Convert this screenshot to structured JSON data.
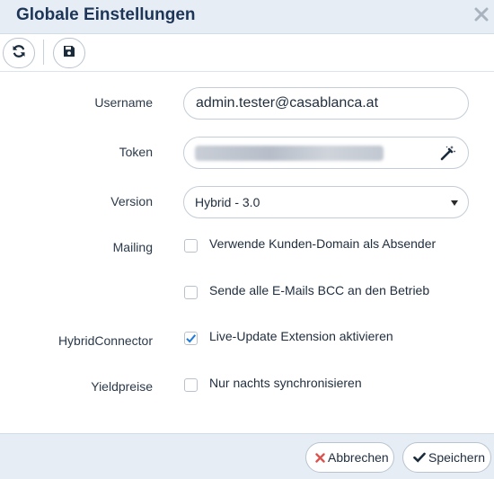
{
  "dialog": {
    "title": "Globale Einstellungen",
    "close_glyph": "✕"
  },
  "toolbar": {
    "refresh_icon": "refresh-icon",
    "save_icon": "floppy-disk-icon"
  },
  "form": {
    "username": {
      "label": "Username",
      "value": "admin.tester@casablanca.at"
    },
    "token": {
      "label": "Token",
      "value_visible": false,
      "action_icon": "magic-wand-icon"
    },
    "version": {
      "label": "Version",
      "selected": "Hybrid - 3.0"
    },
    "mailing": {
      "label": "Mailing",
      "options": [
        {
          "label": "Verwende Kunden-Domain als Absender",
          "checked": false
        },
        {
          "label": "Sende alle E-Mails BCC an den Betrieb",
          "checked": false
        }
      ]
    },
    "hybrid_connector": {
      "label": "HybridConnector",
      "option": {
        "label": "Live-Update Extension aktivieren",
        "checked": true
      }
    },
    "yieldpreise": {
      "label": "Yieldpreise",
      "option": {
        "label": "Nur nachts synchronisieren",
        "checked": false
      }
    }
  },
  "footer": {
    "cancel_label": "Abbrechen",
    "save_label": "Speichern"
  },
  "colors": {
    "header_bg": "#e7edf5",
    "title": "#1d3557",
    "check": "#1e7bd8",
    "cancel_x": "#d9534f"
  }
}
